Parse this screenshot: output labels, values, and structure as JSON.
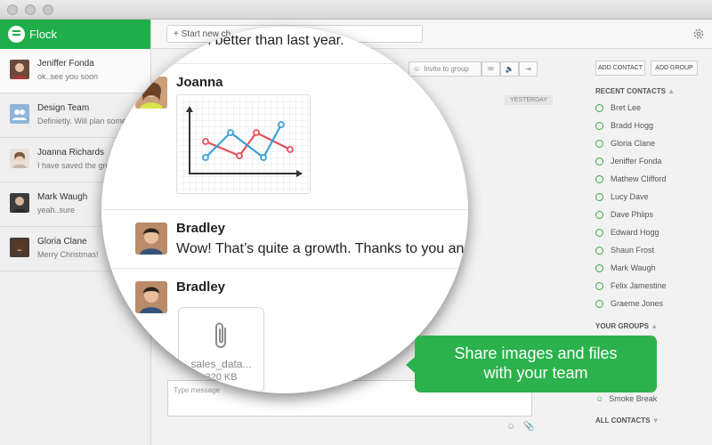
{
  "app": {
    "name": "Flock"
  },
  "conversations": [
    {
      "name": "Jeniffer Fonda",
      "preview": "ok..see you soon"
    },
    {
      "name": "Design Team",
      "preview": "Definietly. Will plan some"
    },
    {
      "name": "Joanna Richards",
      "preview": "I have saved the gre"
    },
    {
      "name": "Mark Waugh",
      "preview": "yeah..sure"
    },
    {
      "name": "Gloria Clane",
      "preview": "Merry Christmas!"
    }
  ],
  "topbar": {
    "new_chat_label": "+ Start new ch"
  },
  "chat": {
    "invite_label": "Invite to group",
    "day_label": "YESTERDAY",
    "message_placeholder": "Type message"
  },
  "magnifier": {
    "prev_text": "much better than last year.",
    "messages": [
      {
        "sender": "Joanna"
      },
      {
        "sender": "Bradley",
        "text": "Wow! That’s quite a growth. Thanks to you and"
      },
      {
        "sender": "Bradley"
      }
    ],
    "file": {
      "name": "sales_data...",
      "size": "320 KB"
    }
  },
  "right_panel": {
    "add_contact": "ADD CONTACT",
    "add_group": "ADD GROUP",
    "recent_header": "RECENT CONTACTS",
    "contacts": [
      "Bret Lee",
      "Bradd Hogg",
      "Gloria Clane",
      "Jeniffer Fonda",
      "Mathew Clifford",
      "Lucy Dave",
      "Dave Phlips",
      "Edward Hogg",
      "Shaun Frost",
      "Mark Waugh",
      "Felix Jamestine",
      "Graeme Jones"
    ],
    "groups_header": "YOUR GROUPS",
    "groups": [
      "Smoke Break"
    ],
    "all_header": "ALL CONTACTS"
  },
  "tooltip": {
    "line1": "Share images and files",
    "line2": "with your team"
  },
  "colors": {
    "brand": "#1fae4a",
    "tooltip": "#2bb24c",
    "chart_red": "#e8505b",
    "chart_blue": "#3aa0d8"
  }
}
